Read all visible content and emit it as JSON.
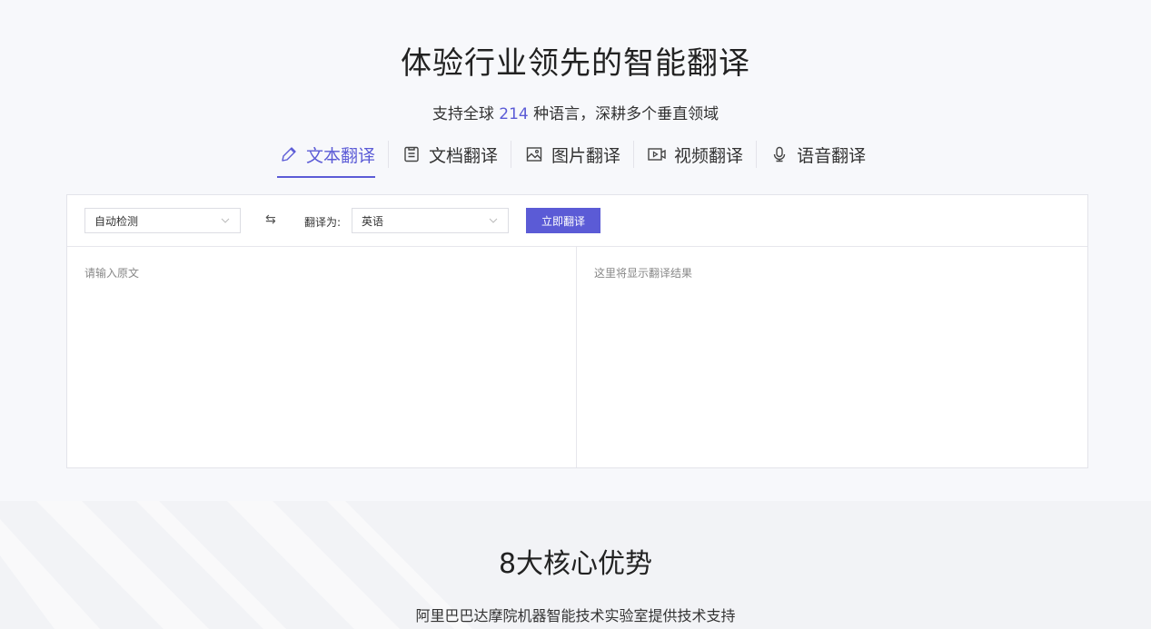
{
  "hero": {
    "title": "体验行业领先的智能翻译",
    "subtitle_pre": "支持全球",
    "subtitle_count": "214",
    "subtitle_post": "种语言，深耕多个垂直领域"
  },
  "tabs": [
    {
      "label": "文本翻译",
      "icon": "pencil-icon",
      "active": true
    },
    {
      "label": "文档翻译",
      "icon": "document-icon",
      "active": false
    },
    {
      "label": "图片翻译",
      "icon": "image-icon",
      "active": false
    },
    {
      "label": "视频翻译",
      "icon": "video-icon",
      "active": false
    },
    {
      "label": "语音翻译",
      "icon": "microphone-icon",
      "active": false
    }
  ],
  "translator": {
    "source_lang": "自动检测",
    "swap_symbol": "⇆",
    "target_label": "翻译为:",
    "target_lang": "英语",
    "translate_button": "立即翻译",
    "input_placeholder": "请输入原文",
    "result_placeholder": "这里将显示翻译结果"
  },
  "advantages": {
    "title": "8大核心优势",
    "subtitle": "阿里巴巴达摩院机器智能技术实验室提供技术支持"
  },
  "colors": {
    "accent": "#5b5bd6",
    "background": "#f7f8fb"
  }
}
